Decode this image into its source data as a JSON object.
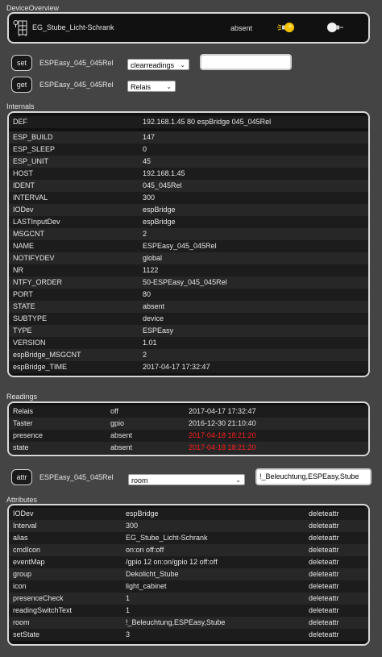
{
  "overview": {
    "title": "DeviceOverview",
    "device_name": "EG_Stube_Licht-Schrank",
    "state": "absent"
  },
  "commands": {
    "set_label": "set",
    "get_label": "get",
    "device": "ESPEasy_045_045Rel",
    "set_select": "clearreadings",
    "get_select": "Relais",
    "set_value": ""
  },
  "internals": {
    "title": "Internals",
    "rows": [
      {
        "k": "DEF",
        "v": "192.168.1.45 80 espBridge 045_045Rel"
      },
      {
        "k": "ESP_BUILD",
        "v": "147"
      },
      {
        "k": "ESP_SLEEP",
        "v": "0"
      },
      {
        "k": "ESP_UNIT",
        "v": "45"
      },
      {
        "k": "HOST",
        "v": "192.168.1.45"
      },
      {
        "k": "IDENT",
        "v": "045_045Rel"
      },
      {
        "k": "INTERVAL",
        "v": "300"
      },
      {
        "k": "IODev",
        "v": "espBridge"
      },
      {
        "k": "LASTInputDev",
        "v": "espBridge"
      },
      {
        "k": "MSGCNT",
        "v": "2"
      },
      {
        "k": "NAME",
        "v": "ESPEasy_045_045Rel"
      },
      {
        "k": "NOTIFYDEV",
        "v": "global"
      },
      {
        "k": "NR",
        "v": "1122"
      },
      {
        "k": "NTFY_ORDER",
        "v": "50-ESPEasy_045_045Rel"
      },
      {
        "k": "PORT",
        "v": "80"
      },
      {
        "k": "STATE",
        "v": "absent"
      },
      {
        "k": "SUBTYPE",
        "v": "device"
      },
      {
        "k": "TYPE",
        "v": "ESPEasy"
      },
      {
        "k": "VERSION",
        "v": "1.01"
      },
      {
        "k": "espBridge_MSGCNT",
        "v": "2"
      },
      {
        "k": "espBridge_TIME",
        "v": "2017-04-17 17:32:47"
      }
    ]
  },
  "readings": {
    "title": "Readings",
    "rows": [
      {
        "k": "Relais",
        "v": "off",
        "t": "2017-04-17 17:32:47",
        "alert": false
      },
      {
        "k": "Taster",
        "v": "gpio",
        "t": "2016-12-30 21:10:40",
        "alert": false
      },
      {
        "k": "presence",
        "v": "absent",
        "t": "2017-04-18 18:21:20",
        "alert": true
      },
      {
        "k": "state",
        "v": "absent",
        "t": "2017-04-18 18:21:20",
        "alert": true
      }
    ],
    "alert_color": "#ff1e1e"
  },
  "attr_cmd": {
    "label": "attr",
    "device": "ESPEasy_045_045Rel",
    "select": "room",
    "value": "!_Beleuchtung,ESPEasy,Stube"
  },
  "attributes": {
    "title": "Attributes",
    "delete_label": "deleteattr",
    "rows": [
      {
        "k": "IODev",
        "v": "espBridge"
      },
      {
        "k": "Interval",
        "v": "300"
      },
      {
        "k": "alias",
        "v": "EG_Stube_Licht-Schrank"
      },
      {
        "k": "cmdIcon",
        "v": "on:on off:off"
      },
      {
        "k": "eventMap",
        "v": "/gpio 12 on:on/gpio 12 off:off"
      },
      {
        "k": "group",
        "v": "Dekolicht_Stube"
      },
      {
        "k": "icon",
        "v": "light_cabinet"
      },
      {
        "k": "presenceCheck",
        "v": "1"
      },
      {
        "k": "readingSwitchText",
        "v": "1"
      },
      {
        "k": "room",
        "v": "!_Beleuchtung,ESPEasy,Stube"
      },
      {
        "k": "setState",
        "v": "3"
      }
    ]
  }
}
